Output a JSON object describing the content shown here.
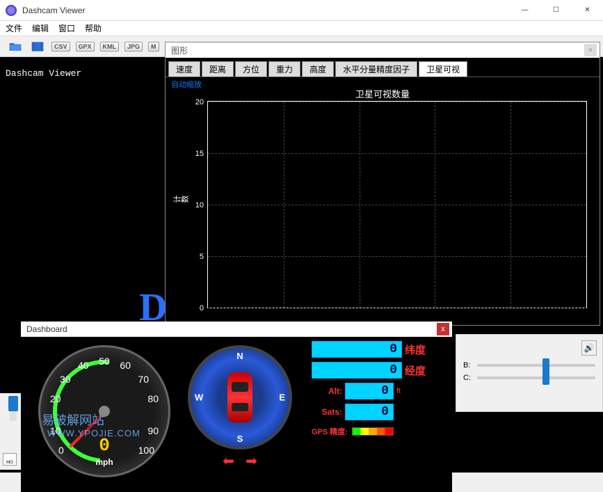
{
  "window": {
    "title": "Dashcam Viewer",
    "minimize": "—",
    "maximize": "☐",
    "close": "✕"
  },
  "menu": {
    "file": "文件",
    "edit": "编辑",
    "window": "窗口",
    "help": "帮助"
  },
  "toolbar": {
    "csv": "CSV",
    "gpx": "GPX",
    "kml": "KML",
    "jpg": "JPG",
    "m": "M"
  },
  "viewer_label": "Dashcam Viewer",
  "chart_panel": {
    "title": "图形",
    "close": "×",
    "tabs": [
      "速度",
      "距离",
      "方位",
      "重力",
      "高度",
      "水平分量精度因子",
      "卫星可视"
    ],
    "active_tab": 6,
    "auto_scale": "自动缩放"
  },
  "chart_data": {
    "type": "line",
    "title": "卫星可视数量",
    "ylabel": "计数",
    "xlabel": "",
    "ylim": [
      0,
      20
    ],
    "yticks": [
      0,
      5,
      10,
      15,
      20
    ],
    "series": [],
    "categories": []
  },
  "dashboard": {
    "title": "Dashboard",
    "close": "x",
    "gauge": {
      "ticks": [
        "0",
        "10",
        "20",
        "30",
        "40",
        "50",
        "60",
        "70",
        "80",
        "90",
        "100"
      ],
      "value": "0",
      "unit": "mph"
    },
    "compass": {
      "n": "N",
      "s": "S",
      "e": "E",
      "w": "W",
      "left_arrow": "⬅",
      "right_arrow": "➡"
    },
    "readouts": {
      "lat_val": "0",
      "lat_label": "纬度",
      "lon_val": "0",
      "lon_label": "经度",
      "alt_label": "Alt:",
      "alt_val": "0",
      "alt_unit": "ft",
      "sats_label": "Sats:",
      "sats_val": "0",
      "gps_label": "GPS 精度:"
    },
    "sliders": {
      "b_label": "B:",
      "c_label": "C:"
    }
  },
  "watermark": {
    "line1": "易破解网站",
    "line2": "WWW.YPOJIE.COM"
  }
}
